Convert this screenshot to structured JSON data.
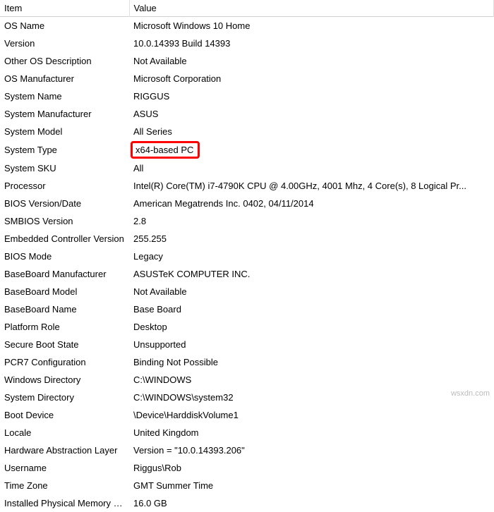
{
  "headers": {
    "item": "Item",
    "value": "Value"
  },
  "rows": [
    {
      "item": "OS Name",
      "value": "Microsoft Windows 10 Home",
      "highlight": false
    },
    {
      "item": "Version",
      "value": "10.0.14393 Build 14393",
      "highlight": false
    },
    {
      "item": "Other OS Description",
      "value": "Not Available",
      "highlight": false
    },
    {
      "item": "OS Manufacturer",
      "value": "Microsoft Corporation",
      "highlight": false
    },
    {
      "item": "System Name",
      "value": "RIGGUS",
      "highlight": false
    },
    {
      "item": "System Manufacturer",
      "value": "ASUS",
      "highlight": false
    },
    {
      "item": "System Model",
      "value": "All Series",
      "highlight": false
    },
    {
      "item": "System Type",
      "value": "x64-based PC",
      "highlight": true
    },
    {
      "item": "System SKU",
      "value": "All",
      "highlight": false
    },
    {
      "item": "Processor",
      "value": "Intel(R) Core(TM) i7-4790K CPU @ 4.00GHz, 4001 Mhz, 4 Core(s), 8 Logical Pr...",
      "highlight": false
    },
    {
      "item": "BIOS Version/Date",
      "value": "American Megatrends Inc. 0402, 04/11/2014",
      "highlight": false
    },
    {
      "item": "SMBIOS Version",
      "value": "2.8",
      "highlight": false
    },
    {
      "item": "Embedded Controller Version",
      "value": "255.255",
      "highlight": false
    },
    {
      "item": "BIOS Mode",
      "value": "Legacy",
      "highlight": false
    },
    {
      "item": "BaseBoard Manufacturer",
      "value": "ASUSTeK COMPUTER INC.",
      "highlight": false
    },
    {
      "item": "BaseBoard Model",
      "value": "Not Available",
      "highlight": false
    },
    {
      "item": "BaseBoard Name",
      "value": "Base Board",
      "highlight": false
    },
    {
      "item": "Platform Role",
      "value": "Desktop",
      "highlight": false
    },
    {
      "item": "Secure Boot State",
      "value": "Unsupported",
      "highlight": false
    },
    {
      "item": "PCR7 Configuration",
      "value": "Binding Not Possible",
      "highlight": false
    },
    {
      "item": "Windows Directory",
      "value": "C:\\WINDOWS",
      "highlight": false
    },
    {
      "item": "System Directory",
      "value": "C:\\WINDOWS\\system32",
      "highlight": false
    },
    {
      "item": "Boot Device",
      "value": "\\Device\\HarddiskVolume1",
      "highlight": false
    },
    {
      "item": "Locale",
      "value": "United Kingdom",
      "highlight": false
    },
    {
      "item": "Hardware Abstraction Layer",
      "value": "Version = \"10.0.14393.206\"",
      "highlight": false
    },
    {
      "item": "Username",
      "value": "Riggus\\Rob",
      "highlight": false
    },
    {
      "item": "Time Zone",
      "value": "GMT Summer Time",
      "highlight": false
    },
    {
      "item": "Installed Physical Memory (RAM)",
      "value": "16.0 GB",
      "highlight": false
    }
  ],
  "watermark": "wsxdn.com",
  "highlight_color": "#ff0000"
}
